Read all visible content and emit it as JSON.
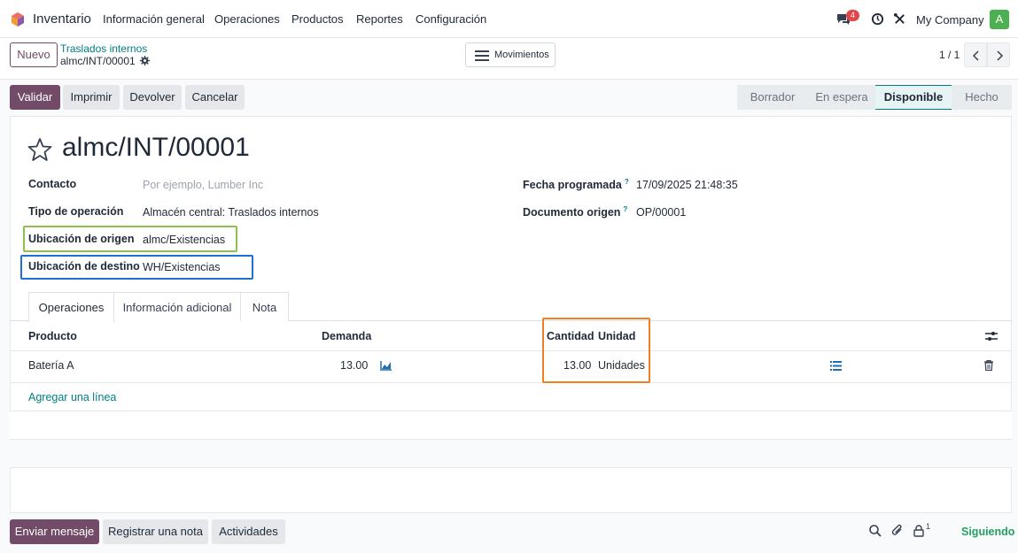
{
  "nav": {
    "app_name": "Inventario",
    "menu": [
      "Información general",
      "Operaciones",
      "Productos",
      "Reportes",
      "Configuración"
    ],
    "chat_badge": "4",
    "company": "My Company",
    "avatar_letter": "A"
  },
  "control": {
    "new_label": "Nuevo",
    "breadcrumb_parent": "Traslados internos",
    "breadcrumb_current": "almc/INT/00001",
    "moves_label": "Movimientos",
    "pager": "1 / 1"
  },
  "actions": {
    "validate": "Validar",
    "print": "Imprimir",
    "return": "Devolver",
    "cancel": "Cancelar"
  },
  "status": {
    "stages": [
      "Borrador",
      "En espera",
      "Disponible",
      "Hecho"
    ],
    "active_stage": "Disponible"
  },
  "record": {
    "title": "almc/INT/00001",
    "contact_label": "Contacto",
    "contact_placeholder": "Por ejemplo, Lumber Inc",
    "operation_type_label": "Tipo de operación",
    "operation_type": "Almacén central: Traslados internos",
    "source_location_label": "Ubicación de origen",
    "source_location": "almc/Existencias",
    "dest_location_label": "Ubicación de destino",
    "dest_location": "WH/Existencias",
    "scheduled_date_label": "Fecha programada",
    "scheduled_date": "17/09/2025 21:48:35",
    "origin_label": "Documento origen",
    "origin": "OP/00001",
    "help_mark": "?"
  },
  "tabs": [
    "Operaciones",
    "Información adicional",
    "Nota"
  ],
  "table": {
    "headers": {
      "product": "Producto",
      "demand": "Demanda",
      "quantity": "Cantidad",
      "unit": "Unidad"
    },
    "rows": [
      {
        "product": "Batería A",
        "demand": "13.00",
        "quantity": "13.00",
        "unit": "Unidades"
      }
    ],
    "add_line": "Agregar una línea"
  },
  "chatter": {
    "send_message": "Enviar mensaje",
    "log_note": "Registrar una nota",
    "activities": "Actividades",
    "followers_count": "1",
    "follow_label": "Siguiendo"
  },
  "colors": {
    "primary": "#714b67",
    "link": "#017e84",
    "highlight_green": "#8bc34a",
    "highlight_blue": "#1f6fd8",
    "highlight_orange": "#f07f22"
  }
}
